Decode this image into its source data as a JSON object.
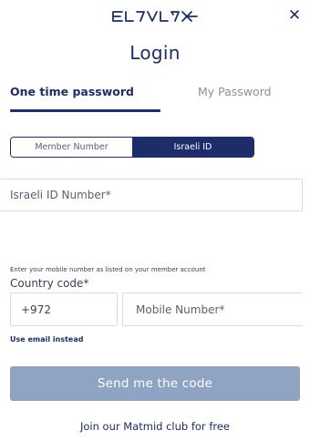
{
  "header": {
    "logo_text": "EL AL",
    "close_icon": "close-icon"
  },
  "title": "Login",
  "tabs": [
    {
      "label": "One time password",
      "active": true
    },
    {
      "label": "My Password",
      "active": false
    }
  ],
  "id_type": {
    "options": [
      {
        "label": "Member Number",
        "selected": false
      },
      {
        "label": "Israeli ID",
        "selected": true
      }
    ]
  },
  "id_field": {
    "placeholder": "Israeli ID Number*",
    "value": ""
  },
  "mobile_section": {
    "hint": "Enter your mobile number as listed on your member account",
    "country_code_label": "Country code*",
    "country_code_value": "+972",
    "mobile_placeholder": "Mobile Number*",
    "mobile_value": ""
  },
  "use_email_link": "Use email instead",
  "send_button": {
    "label": "Send me the code",
    "enabled": false
  },
  "join_link": "Join our Matmid club for free",
  "colors": {
    "brand_navy": "#1d2d6c",
    "button_disabled": "#8fa3c3",
    "border": "#d9dbe2"
  }
}
